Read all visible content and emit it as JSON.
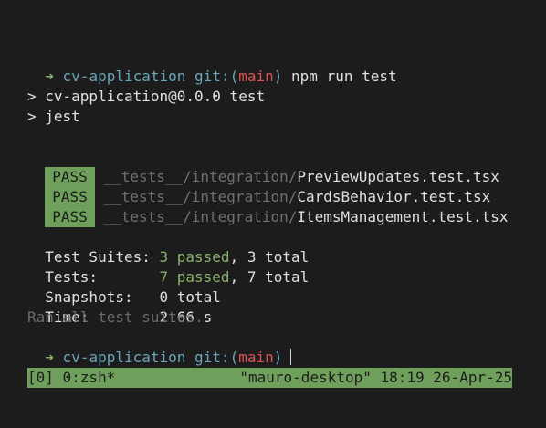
{
  "prompt": {
    "arrow": "➜",
    "dir": "cv-application",
    "git_prefix": "git:(",
    "branch": "main",
    "git_suffix": ")"
  },
  "command": "npm run test",
  "script_output": [
    "> cv-application@0.0.0 test",
    "> jest"
  ],
  "results": [
    {
      "status": "PASS",
      "dir": "__tests__/integration/",
      "file": "PreviewUpdates.test.tsx"
    },
    {
      "status": "PASS",
      "dir": "__tests__/integration/",
      "file": "CardsBehavior.test.tsx"
    },
    {
      "status": "PASS",
      "dir": "__tests__/integration/",
      "file": "ItemsManagement.test.tsx"
    }
  ],
  "summary": {
    "suites_label": "Test Suites: ",
    "suites_passed": "3 passed",
    "suites_total": ", 3 total",
    "tests_label": "Tests:       ",
    "tests_passed": "7 passed",
    "tests_total": ", 7 total",
    "snapshots_label": "Snapshots:   ",
    "snapshots_value": "0 total",
    "time_label": "Time:        ",
    "time_value": "2.66 s",
    "footer": "Ran all test suites."
  },
  "statusbar": {
    "left": "[0] 0:zsh*",
    "right": "\"mauro-desktop\" 18:19 26-Apr-25"
  },
  "colors": {
    "background": "#1c1c1c",
    "pass_badge": "#6ea05b",
    "branch": "#d9544f",
    "dir": "#6aa5b8",
    "arrow": "#8ab169"
  }
}
